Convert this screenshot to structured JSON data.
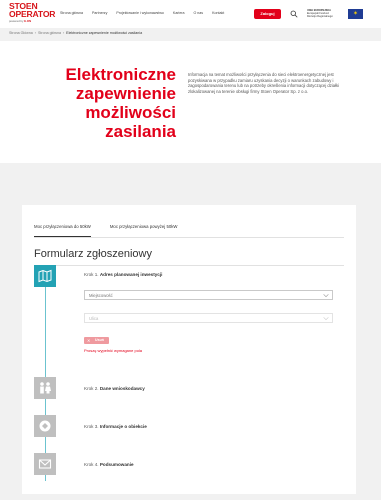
{
  "header": {
    "logo_line1": "STOEN",
    "logo_line2": "OPERATOR",
    "logo_powered": "powered by",
    "logo_brand": "E.ON",
    "nav": [
      "Strona główna",
      "Partnerzy",
      "Projektowanie i wykonawstwo",
      "Kariera",
      "O nas",
      "Kontakt"
    ],
    "login_label": "Zaloguj",
    "eu_badge_line1": "UNIA EUROPEJSKA",
    "eu_badge_line2": "Europejski Fundusz",
    "eu_badge_line3": "Rozwoju Regionalnego"
  },
  "breadcrumb": {
    "items": [
      "Strona Główna",
      "Strona główna"
    ],
    "current": "Elektroniczne zapewnienie możliwości zasilania"
  },
  "hero": {
    "title_line1": "Elektroniczne",
    "title_line2": "zapewnienie",
    "title_line3": "możliwości",
    "title_line4": "zasilania",
    "description": "Informacja na temat możliwości przyłączenia do sieci elektroenergetycznej jest pozyskiwana w przypadku zamiaru uzyskania decyzji o warunkach zabudowy i zagospodarowania terenu lub na potrzeby określenia informacji dotyczącej działki zlokalizowanej na terenie obsługi firmy Stoen Operator Sp. z o.o."
  },
  "form": {
    "tabs": [
      "Moc przyłączeniowa do 50kW",
      "Moc przyłączeniowa powyżej 50kW"
    ],
    "title": "Formularz zgłoszeniowy",
    "step1_prefix": "Krok 1.",
    "step1_name": "Adres planowanej inwestycji",
    "city_placeholder": "Miejscowość",
    "street_placeholder": "Ulica",
    "delete_label": "Usuń",
    "error_text": "Proszę wypełnić wymagane pola",
    "step2_prefix": "Krok 2.",
    "step2_name": "Dane wnioskodawcy",
    "step3_prefix": "Krok 3.",
    "step3_name": "Informacje o obiekcie",
    "step4_prefix": "Krok 4.",
    "step4_name": "Podsumowanie"
  },
  "colors": {
    "brand_red": "#e2001a",
    "active_step": "#23a2b4",
    "inactive_step": "#bfbfbf"
  }
}
